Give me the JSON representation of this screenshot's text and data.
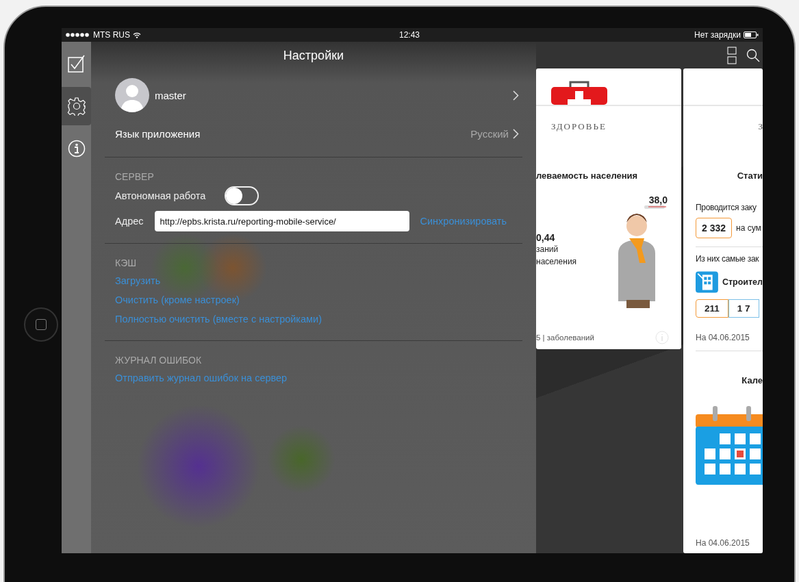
{
  "status_bar": {
    "carrier": "MTS RUS",
    "time": "12:43",
    "battery_label": "Нет зарядки"
  },
  "rail": [
    {
      "kind": "tasks",
      "selected": false
    },
    {
      "kind": "settings",
      "selected": true
    },
    {
      "kind": "info",
      "selected": false
    }
  ],
  "settings": {
    "title": "Настройки",
    "profile": {
      "name": "master"
    },
    "language": {
      "label": "Язык приложения",
      "value": "Русский"
    },
    "sections": [
      {
        "kind": "server",
        "heading": "СЕРВЕР",
        "toggle": {
          "label": "Автономная работа",
          "on": false
        },
        "address": {
          "label": "Адрес",
          "value": "http://epbs.krista.ru/reporting-mobile-service/",
          "action": "Синхронизировать"
        }
      },
      {
        "kind": "links",
        "heading": "КЭШ",
        "links": [
          "Загрузить",
          "Очистить (кроме настроек)",
          "Полностью очистить (вместе с настройками)"
        ]
      },
      {
        "kind": "links",
        "heading": "ЖУРНАЛ ОШИБОК",
        "links": [
          "Отправить журнал ошибок на сервер"
        ]
      }
    ]
  },
  "dashboard": {
    "health_card": {
      "category": "ЗДОРОВЬЕ",
      "title": "леваемость населения",
      "temperature": "38,0",
      "value": "0,44",
      "caption_lines": [
        "заний",
        "населения"
      ],
      "footer": "5 | заболеваний"
    },
    "procurement_card": {
      "category": "З",
      "title": "Стати",
      "line1": "Проводится заку",
      "count": "2 332",
      "count_suffix": "на сум",
      "line2": "Из них самые зак",
      "industry": "Строител",
      "stats": [
        "211",
        "1 7"
      ],
      "date": "На 04.06.2015",
      "calendar_title": "Кале",
      "calendar_date": "На 04.06.2015"
    }
  }
}
